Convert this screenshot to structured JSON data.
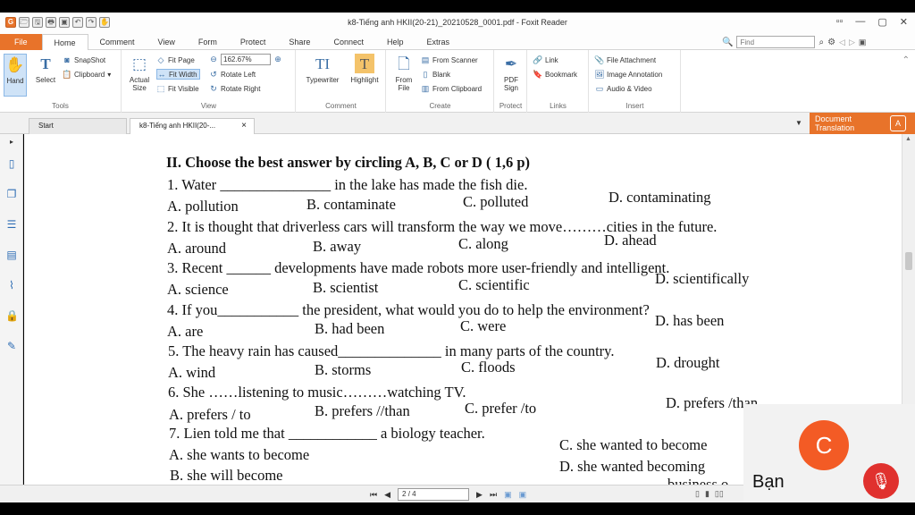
{
  "window": {
    "title": "k8-Tiếng anh HKII(20-21)_20210528_0001.pdf - Foxit Reader",
    "controls": [
      "▫▫",
      "—",
      "▢",
      "✕"
    ]
  },
  "quick_access": [
    "G",
    "🗁",
    "🖫",
    "🖶",
    "▣",
    "↶",
    "↷",
    "✋"
  ],
  "menu": {
    "tabs": [
      "File",
      "Home",
      "Comment",
      "View",
      "Form",
      "Protect",
      "Share",
      "Connect",
      "Help",
      "Extras"
    ],
    "active": "Home",
    "find_placeholder": "Find"
  },
  "ribbon": {
    "tools": {
      "hand": "Hand",
      "select": "Select",
      "snapshot": "SnapShot",
      "clipboard": "Clipboard",
      "label": "Tools"
    },
    "view": {
      "actual_size": "Actual Size",
      "fit_page": "Fit Page",
      "fit_width": "Fit Width",
      "fit_visible": "Fit Visible",
      "zoom": "162.67%",
      "rotate_left": "Rotate Left",
      "rotate_right": "Rotate Right",
      "label": "View"
    },
    "comment": {
      "typewriter": "Typewriter",
      "highlight": "Highlight",
      "label": "Comment"
    },
    "create": {
      "from_file": "From File",
      "from_scanner": "From Scanner",
      "blank": "Blank",
      "from_clipboard": "From Clipboard",
      "label": "Create"
    },
    "protect": {
      "pdf_sign": "PDF Sign",
      "label": "Protect"
    },
    "links": {
      "link": "Link",
      "bookmark": "Bookmark",
      "label": "Links"
    },
    "insert": {
      "file_attachment": "File Attachment",
      "image_annotation": "Image Annotation",
      "audio_video": "Audio & Video",
      "label": "Insert"
    }
  },
  "doc_tabs": {
    "start": "Start",
    "active_doc": "k8-Tiếng anh HKII(20-...",
    "close": "×",
    "translation": "Document Translation"
  },
  "document": {
    "heading": "II. Choose the best answer by circling A, B, C or D ( 1,6 p)",
    "questions": [
      {
        "stem": [
          "1. Water ",
          "_______________",
          " in the lake has made the fish die."
        ],
        "options": [
          "A. pollution",
          "B. contaminate",
          "C. polluted",
          "D. contaminating"
        ]
      },
      {
        "stem": [
          "2. It is thought that driverless cars will transform the way we move………cities in the future."
        ],
        "options": [
          "A. around",
          "B. away",
          "C. along",
          "D. ahead"
        ]
      },
      {
        "stem": [
          "3. Recent ",
          "______",
          " developments have made robots more user-friendly and intelligent."
        ],
        "options": [
          "A. science",
          "B. scientist",
          "C. scientific",
          "D. scientifically"
        ]
      },
      {
        "stem": [
          "4. If you",
          "___________",
          " the president, what would you do to help the environment?"
        ],
        "options": [
          "A. are",
          "B. had been",
          "C. were",
          "D. has been"
        ]
      },
      {
        "stem": [
          "5. The heavy rain has caused",
          "______________",
          " in many parts of the country."
        ],
        "options": [
          "A. wind",
          "B. storms",
          "C. floods",
          "D. drought"
        ]
      },
      {
        "stem": [
          "6. She ……listening to music………watching TV."
        ],
        "options": [
          "A. prefers / to",
          "B. prefers //than",
          "C. prefer /to",
          "D. prefers /than"
        ]
      },
      {
        "stem": [
          "7. Lien told me that ",
          "____________",
          " a biology teacher."
        ],
        "options": [
          "A. she wants to become",
          "B. she will become",
          "C. she wanted to become",
          "D. she wanted becoming"
        ]
      }
    ],
    "cutoff_text": "business o"
  },
  "status": {
    "page_input": "2 / 4",
    "nav": [
      "⏮",
      "◀",
      "▶",
      "⏭"
    ]
  },
  "overlay": {
    "avatar_letter": "C",
    "participant": "Bạn"
  },
  "colors": {
    "accent": "#e8732a",
    "avatar": "#f35b25",
    "mic_off": "#e0312e"
  }
}
